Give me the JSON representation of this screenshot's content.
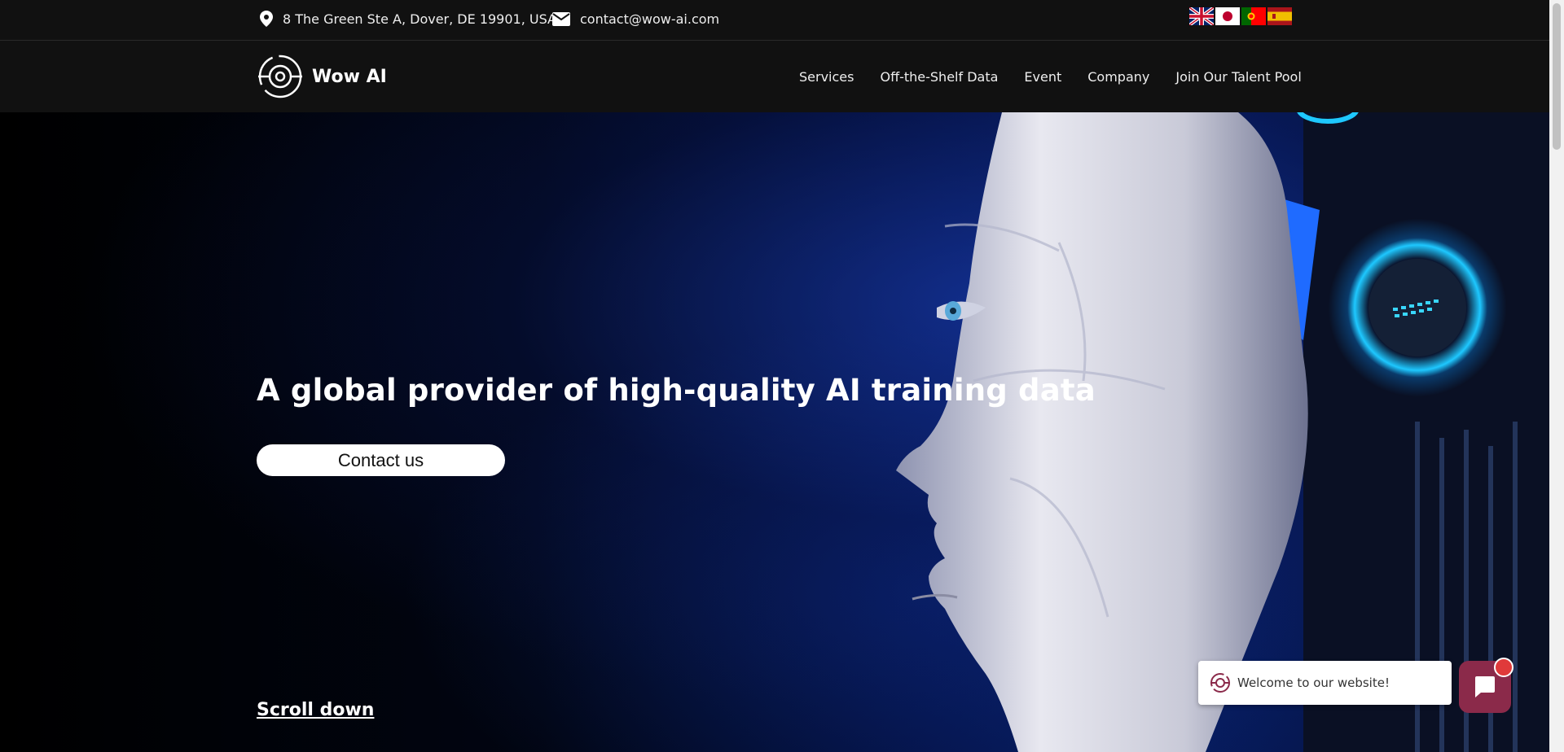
{
  "topbar": {
    "address": "8 The Green Ste A, Dover, DE 19901, USA",
    "email": "contact@wow-ai.com",
    "flags": [
      "uk-flag-icon",
      "japan-flag-icon",
      "portugal-flag-icon",
      "spain-flag-icon"
    ]
  },
  "nav": {
    "brand": "Wow AI",
    "items": [
      "Services",
      "Off-the-Shelf Data",
      "Event",
      "Company",
      "Join Our Talent Pool"
    ]
  },
  "hero": {
    "headline": "A global provider of high-quality AI training data",
    "cta": "Contact us",
    "scroll": "Scroll down"
  },
  "chat": {
    "welcome": "Welcome to our website!"
  },
  "colors": {
    "topbar_bg": "#111111",
    "chat_accent": "#8b2a4a",
    "notification": "#e03a3a"
  }
}
